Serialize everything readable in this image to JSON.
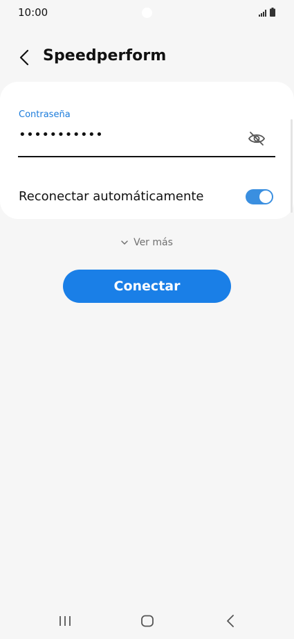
{
  "status_bar": {
    "time": "10:00",
    "icons": [
      "signal-icon",
      "battery-icon"
    ]
  },
  "header": {
    "title": "Speedperform",
    "back_icon": "back-arrow-icon"
  },
  "password_field": {
    "label": "Contraseña",
    "value": "•••••••••••",
    "visibility_icon": "eye-off-icon"
  },
  "auto_reconnect": {
    "label": "Reconectar automáticamente",
    "enabled": true
  },
  "more": {
    "label": "Ver más",
    "icon": "chevron-down-icon"
  },
  "connect_button": {
    "label": "Conectar"
  },
  "colors": {
    "accent": "#1a7fe7",
    "label_blue": "#1a7bdb",
    "toggle_on": "#3a8fe0",
    "background": "#f6f6f6",
    "card": "#ffffff"
  },
  "navbar": {
    "icons": [
      "recents-icon",
      "home-icon",
      "back-icon"
    ]
  }
}
